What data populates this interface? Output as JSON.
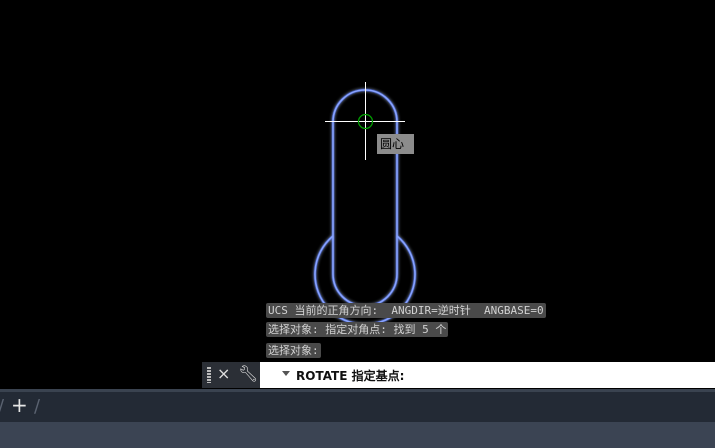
{
  "drawing": {
    "osnap_tooltip": "圆心",
    "entity_color": "#4a78ff",
    "snap_marker_color": "#00a000"
  },
  "command_history": [
    "UCS 当前的正角方向:  ANGDIR=逆时针  ANGBASE=0",
    "选择对象: 指定对角点: 找到 5 个",
    "选择对象:"
  ],
  "command_line": {
    "prompt": "ROTATE 指定基点:",
    "close_icon": "×",
    "customize_icon": "🔧"
  },
  "layout_tabs": {
    "add_label": "+"
  }
}
